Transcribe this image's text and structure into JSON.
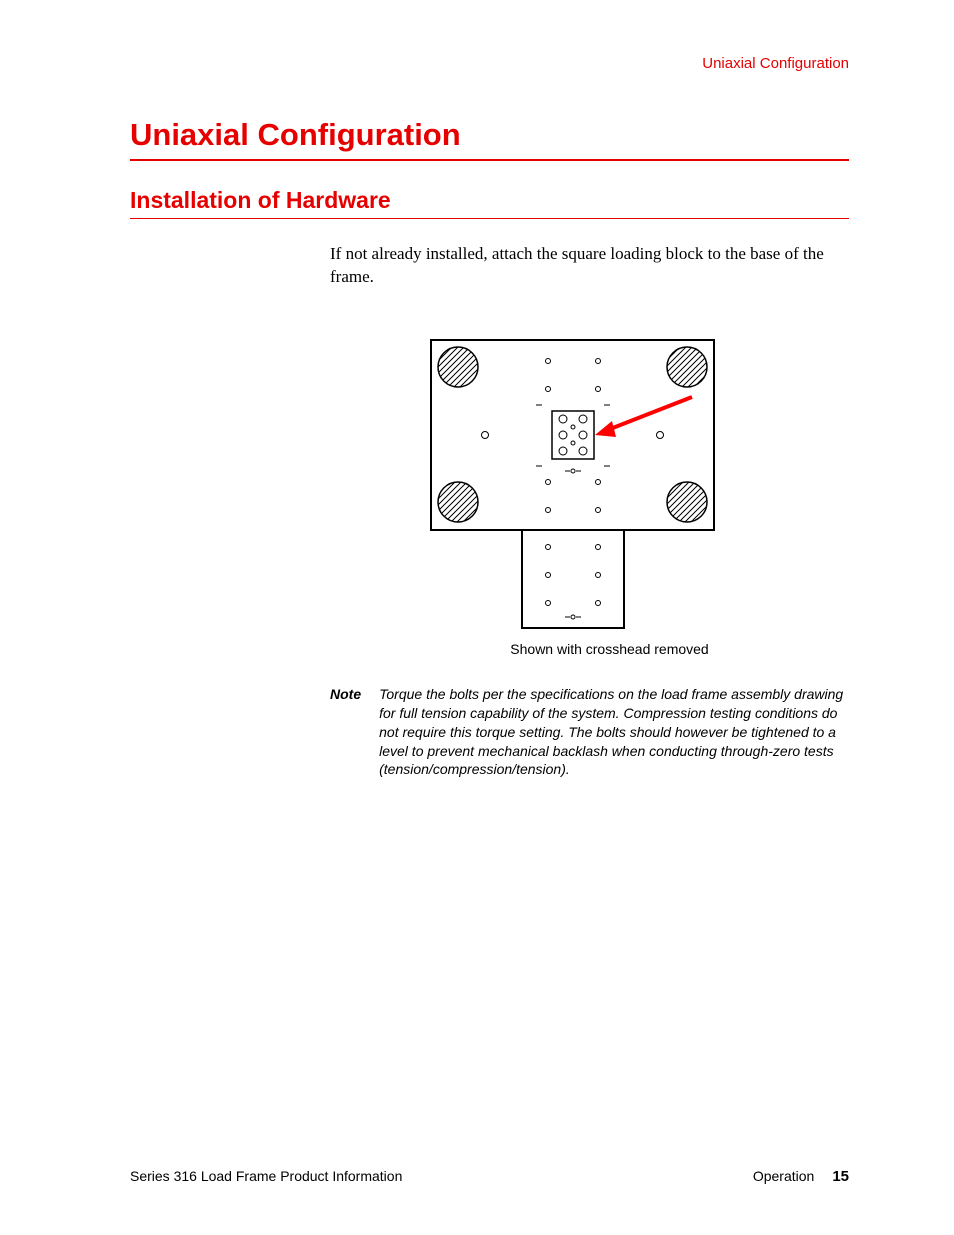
{
  "running_head": "Uniaxial Configuration",
  "chapter_title": "Uniaxial Configuration",
  "section_title": "Installation of Hardware",
  "body_text": "If not already installed, attach the square loading block to the base of the frame.",
  "figure_caption": "Shown with crosshead removed",
  "note_label": "Note",
  "note_body": "Torque the bolts per the specifications on the load frame assembly drawing for full tension capability of the system.  Compression testing conditions do not require this torque setting. The bolts should however be tightened to a level to prevent mechanical backlash when conducting through-zero tests (tension/compression/tension).",
  "footer_left": "Series 316 Load Frame Product Information",
  "footer_section": "Operation",
  "page_number": "15"
}
